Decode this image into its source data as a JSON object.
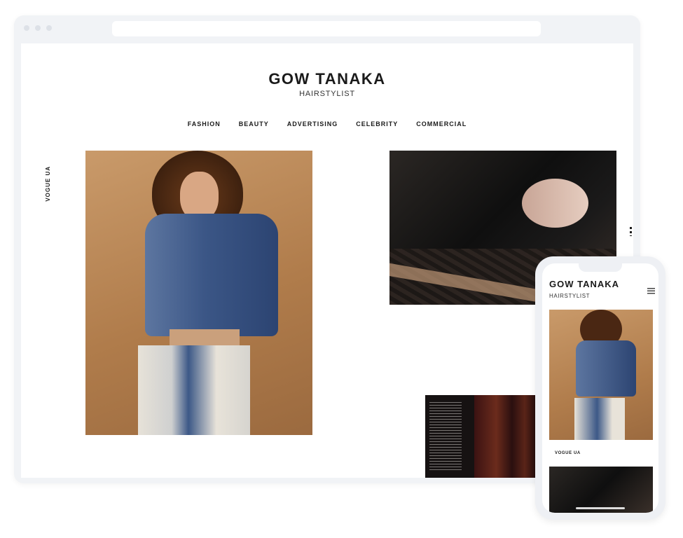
{
  "site": {
    "title": "GOW TANAKA",
    "subtitle": "HAIRSTYLIST"
  },
  "nav": {
    "items": [
      "FASHION",
      "BEAUTY",
      "ADVERTISING",
      "CELEBRITY",
      "COMMERCIAL"
    ]
  },
  "side_label": "VOGUE UA",
  "mobile": {
    "title": "GOW TANAKA",
    "subtitle": "HAIRSTYLIST",
    "caption": "VOGUE UA",
    "menu_icon": "hamburger-icon"
  },
  "colors": {
    "text": "#1a1a1a",
    "browser_frame": "#f1f3f6"
  }
}
